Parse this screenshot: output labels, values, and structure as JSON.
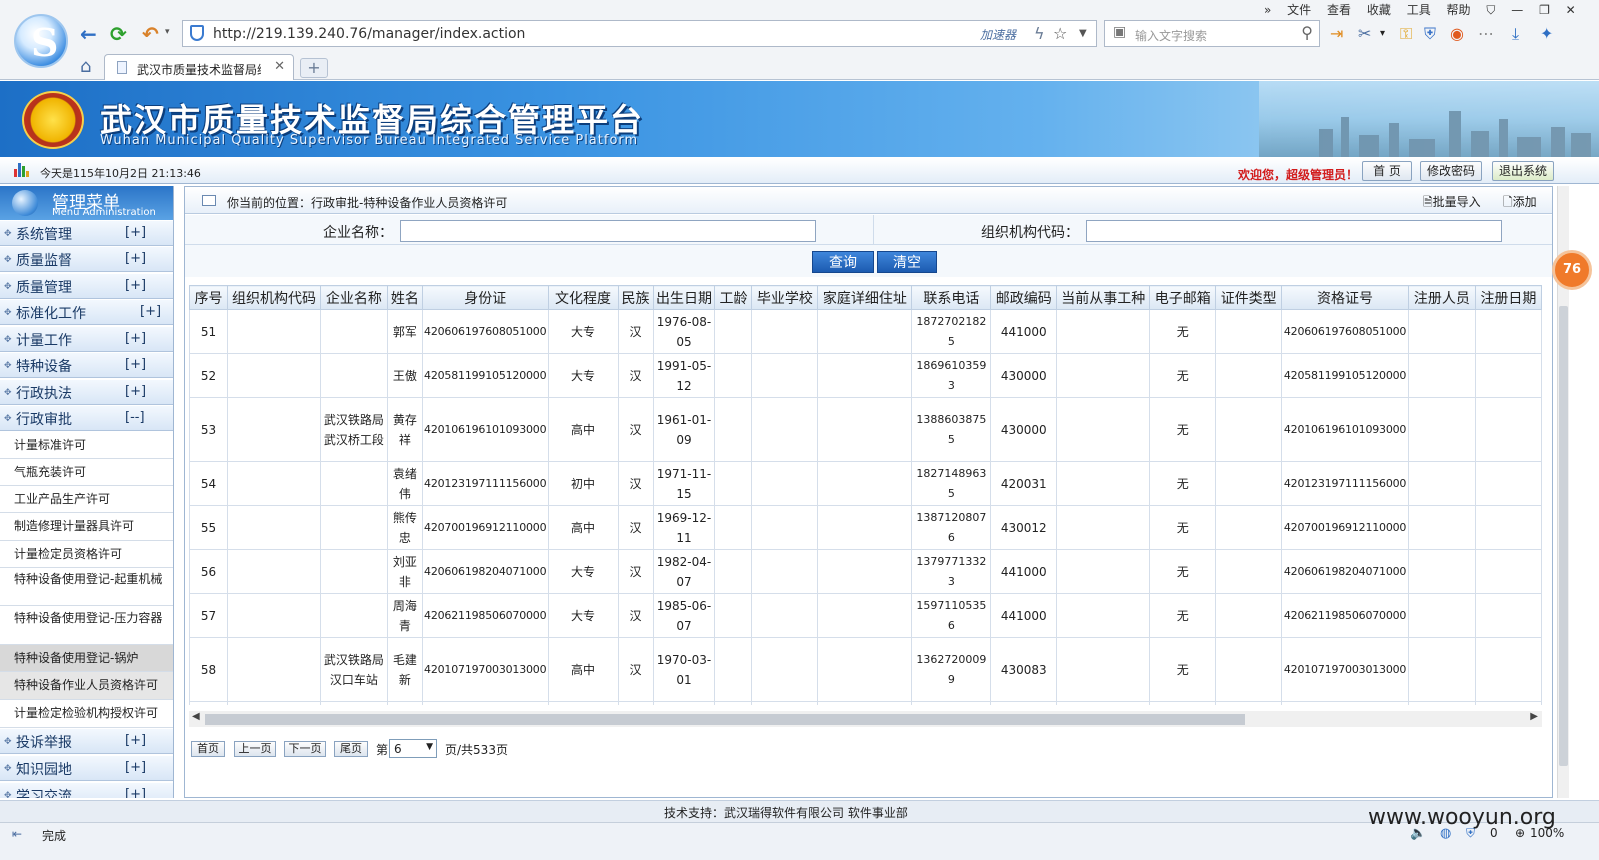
{
  "browser": {
    "url": "http://219.139.240.76/manager/index.action",
    "accelerator": "加速器",
    "search_placeholder": "输入文字搜索",
    "menu": [
      "文件",
      "查看",
      "收藏",
      "工具",
      "帮助"
    ],
    "tab_title": "武汉市质量技术监督局综",
    "status": "完成"
  },
  "header": {
    "title": "武汉市质量技术监督局综合管理平台",
    "subtitle": "Wuhan Municipal Quality Supervisor Bureau Integrated Service Platform",
    "date": "今天是115年10月2日 21:13:46",
    "welcome": "欢迎您，超级管理员！",
    "home_btn": "首 页",
    "pwd_btn": "修改密码",
    "logout_btn": "退出系统"
  },
  "sidebar": {
    "title": "管理菜单",
    "subtitle": "Menu Administration",
    "categories": [
      {
        "label": "系统管理",
        "toggle": "[+]"
      },
      {
        "label": "质量监督",
        "toggle": "[+]"
      },
      {
        "label": "质量管理",
        "toggle": "[+]"
      },
      {
        "label": "标准化工作",
        "toggle": "[+]"
      },
      {
        "label": "计量工作",
        "toggle": "[+]"
      },
      {
        "label": "特种设备",
        "toggle": "[+]"
      },
      {
        "label": "行政执法",
        "toggle": "[+]"
      },
      {
        "label": "行政审批",
        "toggle": "[--]"
      }
    ],
    "subitems": [
      "计量标准许可",
      "气瓶充装许可",
      "工业产品生产许可",
      "制造修理计量器具许可",
      "计量检定员资格许可",
      "特种设备使用登记-起重机械",
      "特种设备使用登记-压力容器",
      "特种设备使用登记-锅炉",
      "特种设备作业人员资格许可",
      "计量检定检验机构授权许可"
    ],
    "bottom": [
      {
        "label": "投诉举报",
        "toggle": "[+]"
      },
      {
        "label": "知识园地",
        "toggle": "[+]"
      },
      {
        "label": "学习交流",
        "toggle": "[+]"
      }
    ]
  },
  "content": {
    "breadcrumb": "你当前的位置：行政审批-特种设备作业人员资格许可",
    "import_btn": "批量导入",
    "add_btn": "添加",
    "form": {
      "company_label": "企业名称：",
      "org_label": "组织机构代码：",
      "company_value": "",
      "org_value": "",
      "query_btn": "查询",
      "clear_btn": "清空"
    },
    "columns": [
      "序号",
      "组织机构代码",
      "企业名称",
      "姓名",
      "身份证",
      "文化程度",
      "民族",
      "出生日期",
      "工龄",
      "毕业学校",
      "家庭详细住址",
      "联系电话",
      "邮政编码",
      "当前从事工种",
      "电子邮箱",
      "证件类型",
      "资格证号",
      "注册人员",
      "注册日期"
    ],
    "rows": [
      [
        "51",
        "",
        "",
        "郭军",
        "420606197608051000",
        "大专",
        "汉",
        "1976-08-05",
        "",
        "",
        "",
        "18727021825",
        "441000",
        "",
        "无",
        "",
        "420606197608051000",
        "",
        ""
      ],
      [
        "52",
        "",
        "",
        "王傲",
        "420581199105120000",
        "大专",
        "汉",
        "1991-05-12",
        "",
        "",
        "",
        "18696103593",
        "430000",
        "",
        "无",
        "",
        "420581199105120000",
        "",
        ""
      ],
      [
        "53",
        "",
        "武汉铁路局武汉桥工段",
        "黄存祥",
        "420106196101093000",
        "高中",
        "汉",
        "1961-01-09",
        "",
        "",
        "",
        "13886038755",
        "430000",
        "",
        "无",
        "",
        "420106196101093000",
        "",
        ""
      ],
      [
        "54",
        "",
        "",
        "袁绪伟",
        "420123197111156000",
        "初中",
        "汉",
        "1971-11-15",
        "",
        "",
        "",
        "18271489635",
        "420031",
        "",
        "无",
        "",
        "420123197111156000",
        "",
        ""
      ],
      [
        "55",
        "",
        "",
        "熊传忠",
        "420700196912110000",
        "高中",
        "汉",
        "1969-12-11",
        "",
        "",
        "",
        "13871208076",
        "430012",
        "",
        "无",
        "",
        "420700196912110000",
        "",
        ""
      ],
      [
        "56",
        "",
        "",
        "刘亚非",
        "420606198204071000",
        "大专",
        "汉",
        "1982-04-07",
        "",
        "",
        "",
        "13797713323",
        "441000",
        "",
        "无",
        "",
        "420606198204071000",
        "",
        ""
      ],
      [
        "57",
        "",
        "",
        "周海青",
        "420621198506070000",
        "大专",
        "汉",
        "1985-06-07",
        "",
        "",
        "",
        "15971105356",
        "441000",
        "",
        "无",
        "",
        "420621198506070000",
        "",
        ""
      ],
      [
        "58",
        "",
        "武汉铁路局汉口车站",
        "毛建新",
        "420107197003013000",
        "高中",
        "汉",
        "1970-03-01",
        "",
        "",
        "",
        "13627200099",
        "430083",
        "",
        "无",
        "",
        "420107197003013000",
        "",
        ""
      ]
    ],
    "pager": {
      "first": "首页",
      "prev": "上一页",
      "next": "下一页",
      "last": "尾页",
      "page_prefix": "第",
      "page_value": "6",
      "total": "页/共533页"
    }
  },
  "footer": "技术支持：武汉瑞得软件有限公司 软件事业部",
  "watermark": "www.wooyun.org",
  "status_right": {
    "zero": "0",
    "zoom": "100%"
  },
  "badge": "76"
}
